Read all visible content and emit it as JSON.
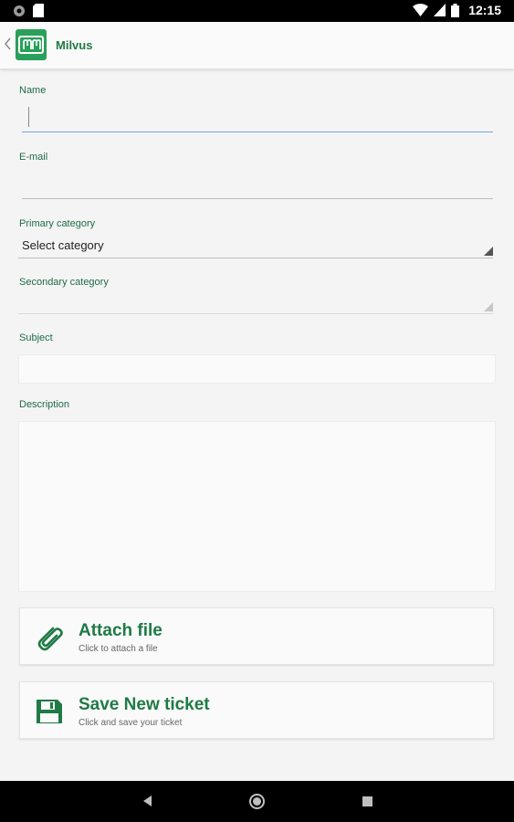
{
  "status_bar": {
    "time": "12:15",
    "icons": [
      "circle-notification-icon",
      "sd-card-icon",
      "wifi-icon",
      "signal-icon",
      "battery-icon"
    ]
  },
  "app_bar": {
    "title": "Milvus",
    "logo_icon": "milvus-logo-icon",
    "back_icon": "chevron-left-icon"
  },
  "form": {
    "name": {
      "label": "Name",
      "value": ""
    },
    "email": {
      "label": "E-mail",
      "value": ""
    },
    "primary_category": {
      "label": "Primary category",
      "selected": "Select category"
    },
    "secondary_category": {
      "label": "Secondary category",
      "selected": ""
    },
    "subject": {
      "label": "Subject",
      "value": ""
    },
    "description": {
      "label": "Description",
      "value": ""
    }
  },
  "actions": {
    "attach": {
      "title": "Attach file",
      "subtitle": "Click to attach a file",
      "icon": "paperclip-icon"
    },
    "save": {
      "title": "Save New ticket",
      "subtitle": "Click and save your ticket",
      "icon": "floppy-disk-icon"
    }
  },
  "nav_bar": {
    "icons": [
      "back-triangle-icon",
      "home-circle-icon",
      "recents-square-icon"
    ]
  },
  "colors": {
    "accent": "#1f7a45",
    "logo": "#2aa05a",
    "focus_line": "#6fa8dc"
  }
}
